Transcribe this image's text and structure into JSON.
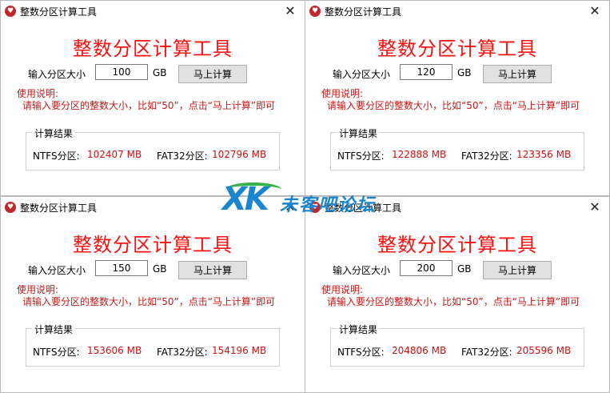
{
  "windows": [
    {
      "title": "整数分区计算工具",
      "heading": "整数分区计算工具",
      "size_label": "输入分区大小",
      "size_value": "100",
      "unit": "GB",
      "calc_button": "马上计算",
      "usage_title": "使用说明:",
      "usage_text": "请输入要分区的整数大小，比如“50”，点击“马上计算”即可",
      "result_title": "计算结果",
      "ntfs_label": "NTFS分区:",
      "ntfs_value": "102407 MB",
      "fat32_label": "FAT32分区:",
      "fat32_value": "102796 MB"
    },
    {
      "title": "整数分区计算工具",
      "heading": "整数分区计算工具",
      "size_label": "输入分区大小",
      "size_value": "120",
      "unit": "GB",
      "calc_button": "马上计算",
      "usage_title": "使用说明:",
      "usage_text": "请输入要分区的整数大小，比如“50”，点击“马上计算”即可",
      "result_title": "计算结果",
      "ntfs_label": "NTFS分区:",
      "ntfs_value": "122888 MB",
      "fat32_label": "FAT32分区:",
      "fat32_value": "123356 MB"
    },
    {
      "title": "整数分区计算工具",
      "heading": "整数分区计算工具",
      "size_label": "输入分区大小",
      "size_value": "150",
      "unit": "GB",
      "calc_button": "马上计算",
      "usage_title": "使用说明:",
      "usage_text": "请输入要分区的整数大小，比如“50”，点击“马上计算”即可",
      "result_title": "计算结果",
      "ntfs_label": "NTFS分区:",
      "ntfs_value": "153606 MB",
      "fat32_label": "FAT32分区:",
      "fat32_value": "154196 MB"
    },
    {
      "title": "整数分区计算工具",
      "heading": "整数分区计算工具",
      "size_label": "输入分区大小",
      "size_value": "200",
      "unit": "GB",
      "calc_button": "马上计算",
      "usage_title": "使用说明:",
      "usage_text": "请输入要分区的整数大小，比如“50”，点击“马上计算”即可",
      "result_title": "计算结果",
      "ntfs_label": "NTFS分区:",
      "ntfs_value": "204806 MB",
      "fat32_label": "FAT32分区:",
      "fat32_value": "205596 MB"
    }
  ],
  "watermark": {
    "logo_text": "XK",
    "site_text": "未客吧论坛"
  },
  "colors": {
    "heading": "#ff1010",
    "usage": "#c81818",
    "result_value": "#d01010",
    "app_icon": "#c0272d",
    "watermark_blue": "#1a86d0",
    "watermark_green": "#36b24a"
  },
  "icons": {
    "app": "app-logo-icon",
    "close": "close-icon"
  }
}
